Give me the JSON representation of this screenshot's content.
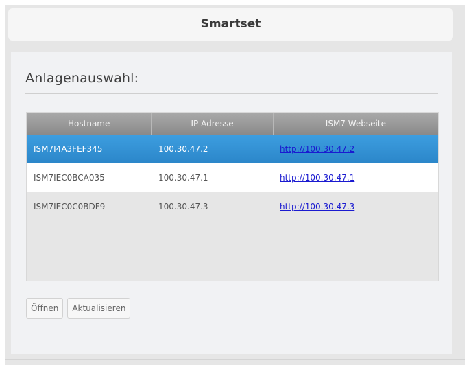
{
  "header": {
    "title": "Smartset"
  },
  "section": {
    "title": "Anlagenauswahl:"
  },
  "table": {
    "columns": [
      "Hostname",
      "IP-Adresse",
      "ISM7 Webseite"
    ],
    "rows": [
      {
        "hostname": "ISM7I4A3FEF345",
        "ip": "100.30.47.2",
        "url": "http://100.30.47.2",
        "selected": true
      },
      {
        "hostname": "ISM7IEC0BCA035",
        "ip": "100.30.47.1",
        "url": "http://100.30.47.1",
        "selected": false
      },
      {
        "hostname": "ISM7IEC0C0BDF9",
        "ip": "100.30.47.3",
        "url": "http://100.30.47.3",
        "selected": false
      }
    ]
  },
  "buttons": {
    "open": "Öffnen",
    "refresh": "Aktualisieren"
  },
  "colors": {
    "selected_row": "#2b86c9",
    "header_bg": "#9a9a9a",
    "link": "#1a1ad0"
  }
}
